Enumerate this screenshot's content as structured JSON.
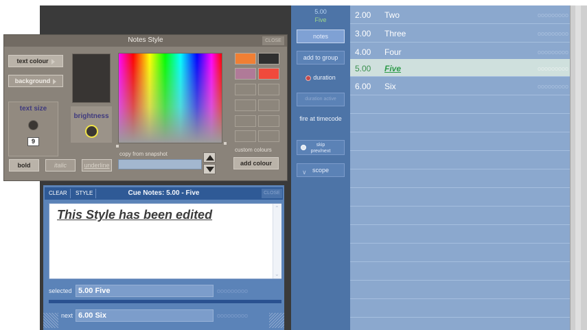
{
  "cue_list": {
    "rows": [
      {
        "num": "2.00",
        "name": "Two",
        "dots": "ooooooooo"
      },
      {
        "num": "3.00",
        "name": "Three",
        "dots": "ooooooooo"
      },
      {
        "num": "4.00",
        "name": "Four",
        "dots": "ooooooooo"
      },
      {
        "num": "5.00",
        "name": "Five",
        "dots": "ooooooooo"
      },
      {
        "num": "6.00",
        "name": "Six",
        "dots": "ooooooooo"
      }
    ]
  },
  "side_panel": {
    "snapshot_num": "5.00",
    "snapshot_name": "Five",
    "notes": "notes",
    "add_to_group": "add to group",
    "duration": "duration",
    "duration_active": "duration active",
    "fire_at_timecode": "fire at timecode",
    "skip_line1": "skip",
    "skip_line2": "prev/next",
    "scope": "scope"
  },
  "notes_style": {
    "title": "Notes Style",
    "close": "CLOSE",
    "text_colour": "text colour",
    "background": "background",
    "text_size_label": "text size",
    "text_size_value": "9",
    "brightness_label": "brightness",
    "copy_from_snapshot": "copy from snapshot",
    "custom_colours": "custom colours",
    "add_colour": "add colour",
    "bold": "bold",
    "italic": "italic",
    "underline": "underline",
    "swatches": [
      "#f07f34",
      "#2f2f2f",
      "#b07a98",
      "#f04a3c"
    ]
  },
  "cue_notes": {
    "clear": "CLEAR",
    "style": "STYLE",
    "title": "Cue Notes: 5.00 - Five",
    "close": "CLOSE",
    "text": "This Style has been edited",
    "selected_label": "selected",
    "selected_value": "5.00  Five",
    "next_label": "next",
    "next_value": "6.00  Six",
    "dots": "ooooooooo"
  }
}
